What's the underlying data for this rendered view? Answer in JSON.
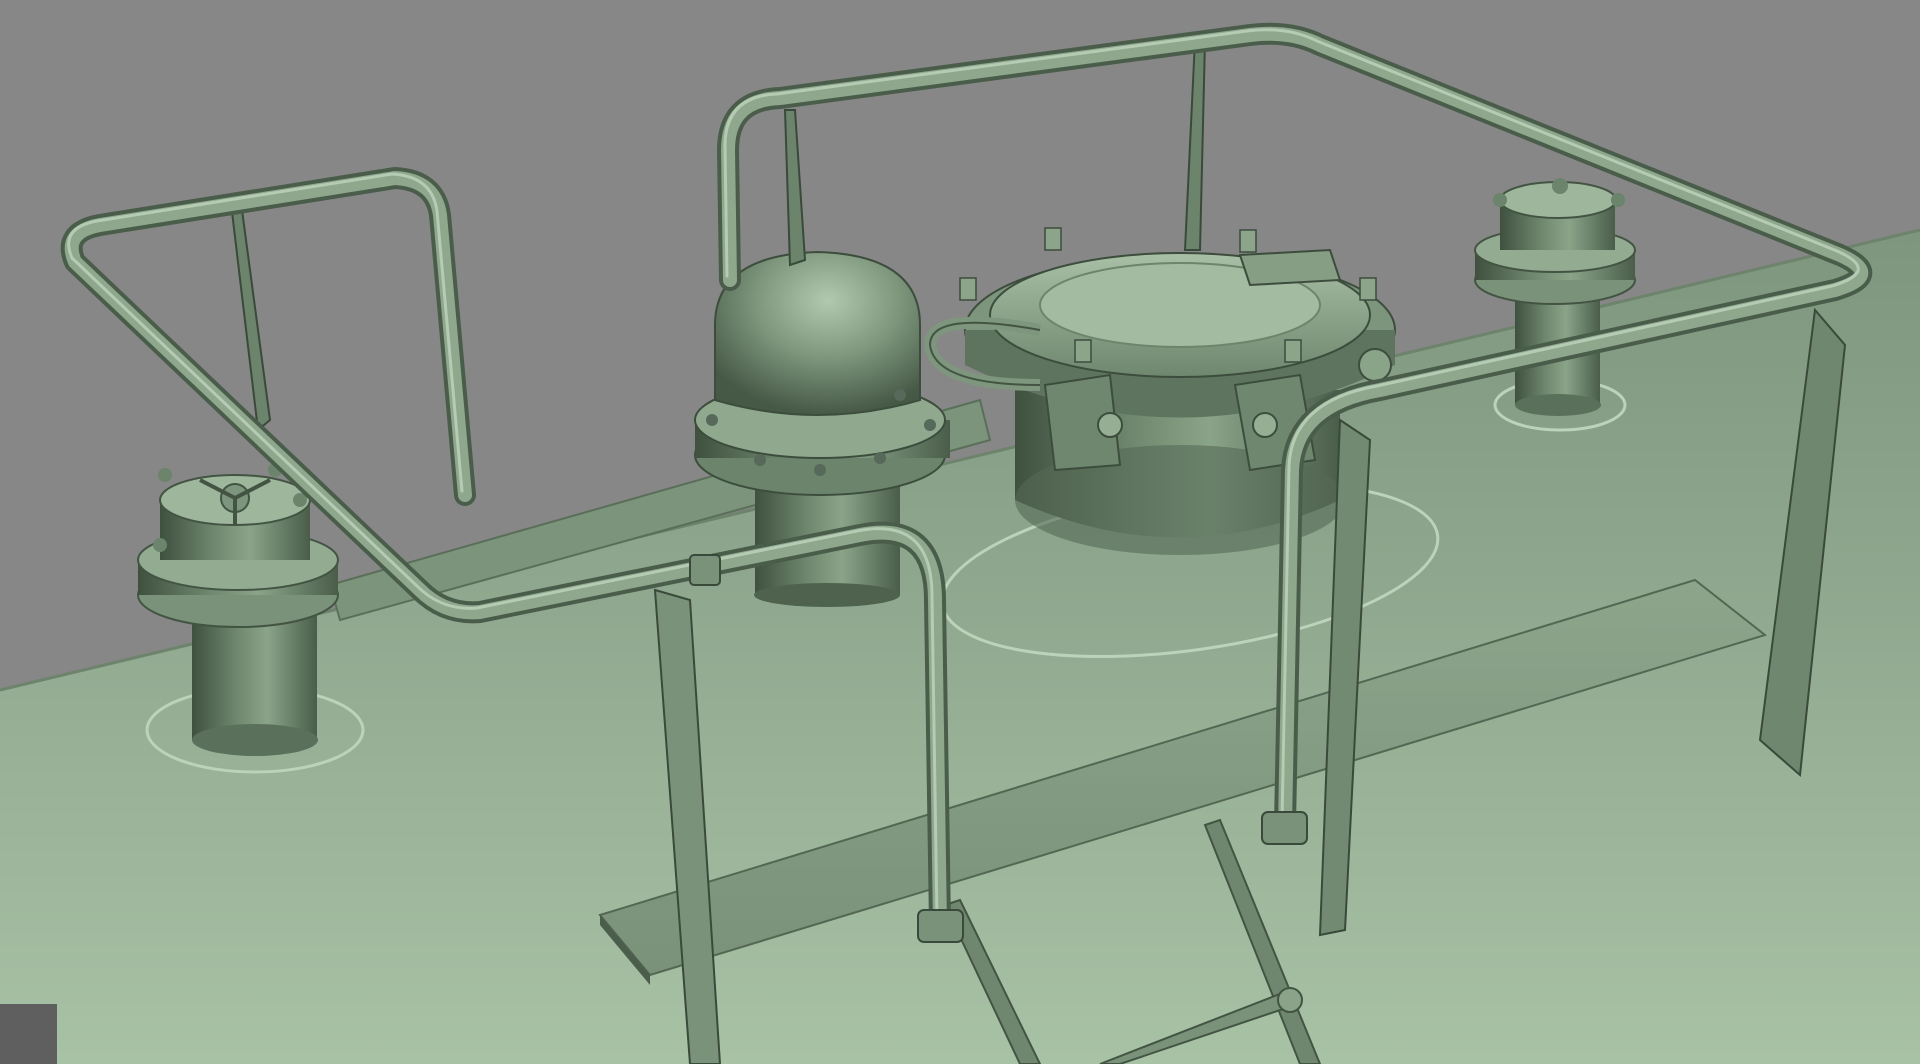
{
  "viewport": {
    "background_color": "#878787",
    "model_color": "#96b096",
    "model_shadow_color": "#425242",
    "model_highlight_color": "#c6dcc4",
    "corner_block_color": "#5f5f5f"
  },
  "scene": {
    "description_visible_text": "",
    "objects": [
      "tank-body",
      "walkway-platform",
      "left-guard-rail",
      "main-guard-rail",
      "domed-vent-cylinder",
      "manhole-hatch",
      "left-flanged-valve",
      "right-flanged-valve",
      "ladder",
      "rail-support-posts"
    ]
  }
}
